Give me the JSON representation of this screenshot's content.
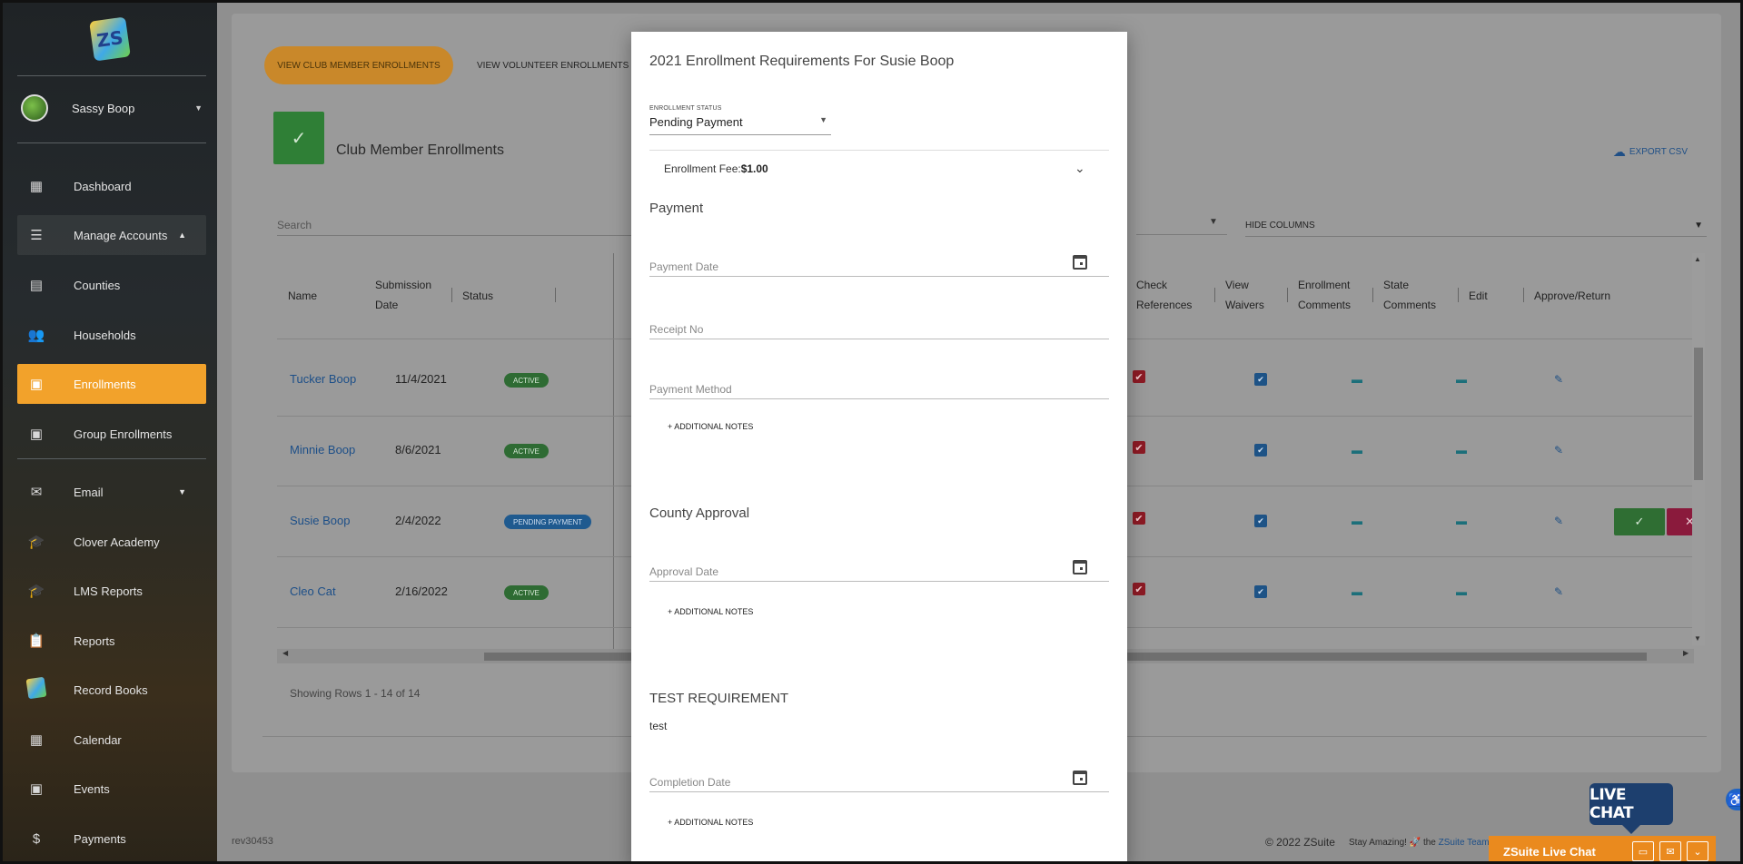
{
  "sidebar": {
    "logo_text": "ZS",
    "user_name": "Sassy Boop",
    "items": [
      {
        "label": "Dashboard",
        "icon": "dashboard-icon"
      },
      {
        "label": "Manage Accounts",
        "icon": "list-icon"
      },
      {
        "label": "Counties",
        "icon": "document-icon"
      },
      {
        "label": "Households",
        "icon": "people-icon"
      },
      {
        "label": "Enrollments",
        "icon": "card-icon"
      },
      {
        "label": "Group Enrollments",
        "icon": "card-icon"
      },
      {
        "label": "Email",
        "icon": "mail-icon"
      },
      {
        "label": "Clover Academy",
        "icon": "school-icon"
      },
      {
        "label": "LMS Reports",
        "icon": "school-icon"
      },
      {
        "label": "Reports",
        "icon": "clipboard-icon"
      },
      {
        "label": "Record Books",
        "icon": "zs-logo-icon"
      },
      {
        "label": "Calendar",
        "icon": "calendar-icon"
      },
      {
        "label": "Events",
        "icon": "event-icon"
      },
      {
        "label": "Payments",
        "icon": "dollar-icon"
      }
    ]
  },
  "main": {
    "tabs": [
      "VIEW CLUB MEMBER ENROLLMENTS",
      "VIEW VOLUNTEER ENROLLMENTS"
    ],
    "page_title": "Club Member Enrollments",
    "export_label": "EXPORT CSV",
    "search_placeholder": "Search",
    "hide_columns_label": "HIDE COLUMNS",
    "columns_left": {
      "name": "Name",
      "submission_1": "Submission",
      "submission_2": "Date",
      "status": "Status"
    },
    "columns_right": {
      "check_1": "Check",
      "check_2": "References",
      "waivers_1": "View",
      "waivers_2": "Waivers",
      "enroll_1": "Enrollment",
      "enroll_2": "Comments",
      "state_1": "State",
      "state_2": "Comments",
      "edit": "Edit",
      "approve": "Approve/Return"
    },
    "rows": [
      {
        "name": "Tucker Boop",
        "date": "11/4/2021",
        "status": "ACTIVE"
      },
      {
        "name": "Minnie Boop",
        "date": "8/6/2021",
        "status": "ACTIVE"
      },
      {
        "name": "Susie Boop",
        "date": "2/4/2022",
        "status": "PENDING PAYMENT"
      },
      {
        "name": "Cleo Cat",
        "date": "2/16/2022",
        "status": "ACTIVE"
      }
    ],
    "showing": "Showing Rows 1 - 14 of 14",
    "revision": "rev30453",
    "copyright": "© 2022 ZSuite",
    "stay_amazing": "Stay Amazing!",
    "the": "the",
    "team_link": "ZSuite Team"
  },
  "modal": {
    "title": "2021 Enrollment Requirements For Susie Boop",
    "status_label": "ENROLLMENT STATUS",
    "status_value": "Pending Payment",
    "fee_label": "Enrollment Fee:",
    "fee_value": "$1.00",
    "payment_section": "Payment",
    "payment_date": "Payment Date",
    "receipt_no": "Receipt No",
    "payment_method": "Payment Method",
    "additional_notes": "+ ADDITIONAL NOTES",
    "county_section": "County Approval",
    "approval_date": "Approval Date",
    "test_section": "TEST REQUIREMENT",
    "test_desc": "test",
    "completion_date": "Completion Date"
  },
  "live_chat": {
    "bubble": "LIVE CHAT",
    "bar_title": "ZSuite Live Chat"
  },
  "colors": {
    "accent": "#f2a22b",
    "active_badge": "#2e7d32",
    "pending_badge": "#1e88e5",
    "link": "#1976d2",
    "live_chat": "#ea8a1e"
  }
}
